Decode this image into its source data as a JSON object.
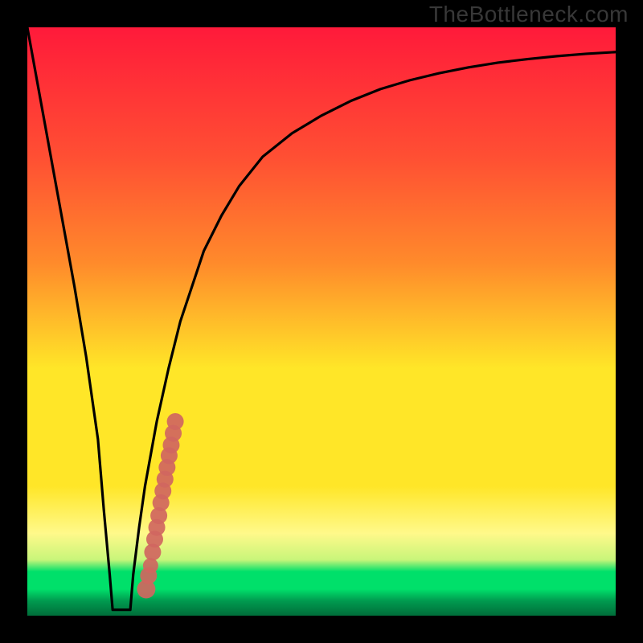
{
  "watermark": "TheBottleneck.com",
  "colors": {
    "black": "#000000",
    "curve": "#000000",
    "dots": "#d0665f",
    "gradient_top": "#ff1a3a",
    "gradient_mid_upper": "#ff8a2b",
    "gradient_mid": "#ffe628",
    "gradient_mid_lower": "#fff98a",
    "gradient_green": "#00e06a",
    "gradient_green_dark": "#009a4f"
  },
  "chart_data": {
    "type": "line",
    "title": "",
    "xlabel": "",
    "ylabel": "",
    "xlim": [
      0,
      100
    ],
    "ylim": [
      0,
      100
    ],
    "x": [
      0,
      2,
      4,
      6,
      8,
      10,
      12,
      13,
      14,
      15,
      16,
      17,
      18,
      19,
      20,
      22,
      24,
      26,
      28,
      30,
      33,
      36,
      40,
      45,
      50,
      55,
      60,
      65,
      70,
      75,
      80,
      85,
      90,
      95,
      100
    ],
    "values": [
      100,
      89,
      78,
      67,
      56,
      44,
      30,
      18,
      7,
      1,
      1,
      1,
      7,
      15,
      22,
      33,
      42,
      50,
      56,
      62,
      68,
      73,
      78,
      82,
      85,
      87.5,
      89.5,
      91,
      92.2,
      93.2,
      94,
      94.6,
      95.1,
      95.5,
      95.8
    ],
    "flat_band": {
      "x_start": 14.5,
      "x_end": 17.5,
      "y": 1
    },
    "series": [
      {
        "name": "dots",
        "type": "scatter",
        "x": [
          20.2,
          20.6,
          20.95,
          21.3,
          21.65,
          22.0,
          22.35,
          22.7,
          23.05,
          23.4,
          23.75,
          24.1,
          24.45,
          24.8,
          25.15
        ],
        "values": [
          4.5,
          6.8,
          8.5,
          10.8,
          13.0,
          15.0,
          17.0,
          19.2,
          21.2,
          23.2,
          25.2,
          27.2,
          29.0,
          31.0,
          33.0
        ]
      }
    ]
  }
}
